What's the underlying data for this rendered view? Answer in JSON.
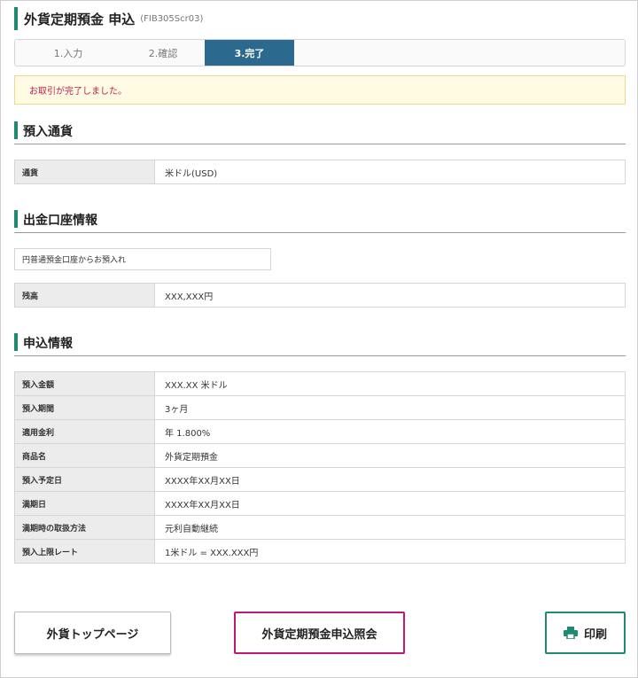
{
  "title": {
    "main": "外貨定期預金 申込",
    "code": "(FIB305Scr03)"
  },
  "steps": [
    {
      "label": "1.入力"
    },
    {
      "label": "2.確認"
    },
    {
      "label": "3.完了"
    }
  ],
  "notice": "お取引が完了しました。",
  "sections": {
    "currency": {
      "heading": "預入通貨",
      "rows": [
        {
          "label": "通貨",
          "value": "米ドル(USD)"
        }
      ]
    },
    "account": {
      "heading": "出金口座情報",
      "account_name": "円普通預金口座からお預入れ",
      "rows": [
        {
          "label": "残高",
          "value": "XXX,XXX円"
        }
      ]
    },
    "application": {
      "heading": "申込情報",
      "rows": [
        {
          "label": "預入金額",
          "value": "XXX.XX 米ドル"
        },
        {
          "label": "預入期間",
          "value": "3ヶ月"
        },
        {
          "label": "適用金利",
          "value": "年 1.800%"
        },
        {
          "label": "商品名",
          "value": "外貨定期預金"
        },
        {
          "label": "預入予定日",
          "value": "XXXX年XX月XX日"
        },
        {
          "label": "満期日",
          "value": "XXXX年XX月XX日"
        },
        {
          "label": "満期時の取扱方法",
          "value": "元利自動継続"
        },
        {
          "label": "預入上限レート",
          "value": "1米ドル = XXX.XXX円"
        }
      ]
    }
  },
  "buttons": {
    "top_label": "外貨トップページ",
    "inquiry_label": "外貨定期預金申込照会",
    "print_label": "印刷"
  },
  "icons": {
    "print": "printer-icon"
  },
  "colors": {
    "accent_green": "#1f8a70",
    "step_active": "#2b6a8e",
    "notice_text": "#c0204d",
    "inquiry_border": "#c0187a"
  }
}
